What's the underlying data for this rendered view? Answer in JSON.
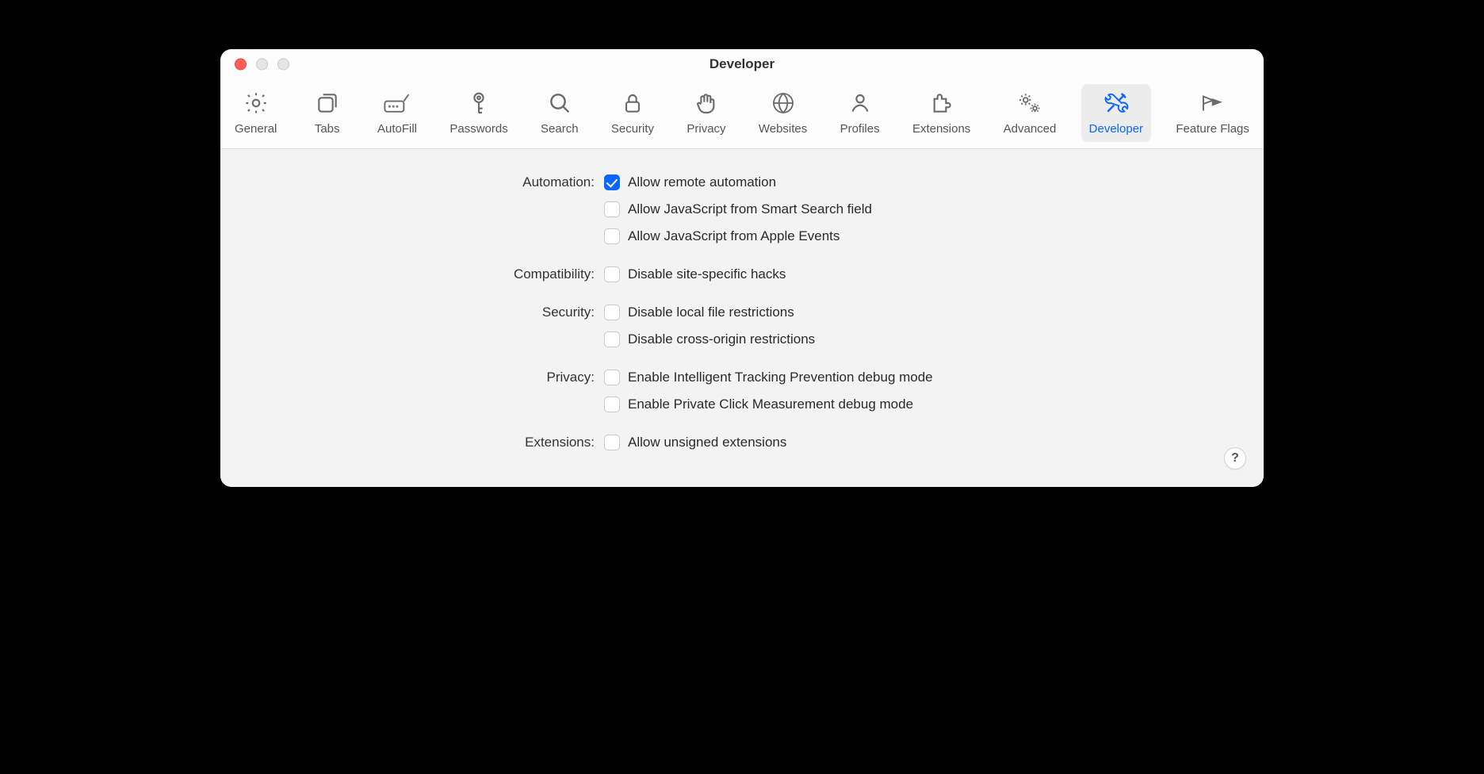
{
  "window": {
    "title": "Developer"
  },
  "tabs": [
    {
      "id": "general",
      "label": "General"
    },
    {
      "id": "tabs",
      "label": "Tabs"
    },
    {
      "id": "autofill",
      "label": "AutoFill"
    },
    {
      "id": "passwords",
      "label": "Passwords"
    },
    {
      "id": "search",
      "label": "Search"
    },
    {
      "id": "security",
      "label": "Security"
    },
    {
      "id": "privacy",
      "label": "Privacy"
    },
    {
      "id": "websites",
      "label": "Websites"
    },
    {
      "id": "profiles",
      "label": "Profiles"
    },
    {
      "id": "extensions",
      "label": "Extensions"
    },
    {
      "id": "advanced",
      "label": "Advanced"
    },
    {
      "id": "developer",
      "label": "Developer",
      "active": true
    },
    {
      "id": "featureflags",
      "label": "Feature Flags"
    }
  ],
  "sections": {
    "automation": {
      "label": "Automation:",
      "items": [
        {
          "label": "Allow remote automation",
          "checked": true
        },
        {
          "label": "Allow JavaScript from Smart Search field",
          "checked": false
        },
        {
          "label": "Allow JavaScript from Apple Events",
          "checked": false
        }
      ]
    },
    "compatibility": {
      "label": "Compatibility:",
      "items": [
        {
          "label": "Disable site-specific hacks",
          "checked": false
        }
      ]
    },
    "security": {
      "label": "Security:",
      "items": [
        {
          "label": "Disable local file restrictions",
          "checked": false
        },
        {
          "label": "Disable cross-origin restrictions",
          "checked": false
        }
      ]
    },
    "privacy": {
      "label": "Privacy:",
      "items": [
        {
          "label": "Enable Intelligent Tracking Prevention debug mode",
          "checked": false
        },
        {
          "label": "Enable Private Click Measurement debug mode",
          "checked": false
        }
      ]
    },
    "extensions": {
      "label": "Extensions:",
      "items": [
        {
          "label": "Allow unsigned extensions",
          "checked": false
        }
      ]
    }
  },
  "help": "?"
}
